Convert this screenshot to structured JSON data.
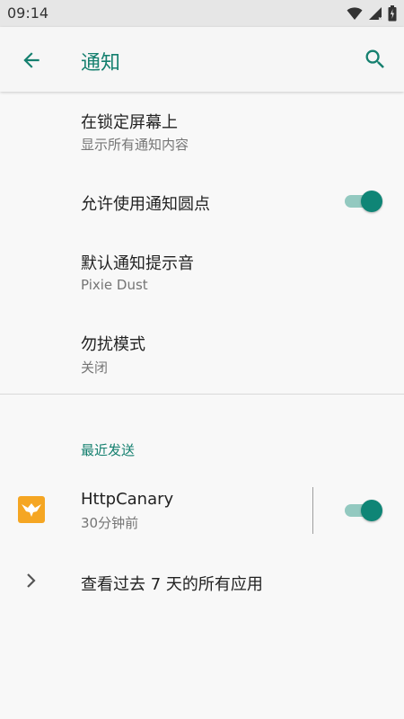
{
  "status_bar": {
    "time": "09:14",
    "icons": [
      "wifi-icon",
      "signal-icon",
      "battery-icon"
    ]
  },
  "app_bar": {
    "title": "通知",
    "back_icon": "arrow-back-icon",
    "search_icon": "search-icon"
  },
  "settings": {
    "lock_screen": {
      "title": "在锁定屏幕上",
      "subtitle": "显示所有通知内容"
    },
    "dots": {
      "title": "允许使用通知圆点",
      "enabled": true
    },
    "sound": {
      "title": "默认通知提示音",
      "subtitle": "Pixie Dust"
    },
    "dnd": {
      "title": "勿扰模式",
      "subtitle": "关闭"
    }
  },
  "recent": {
    "header": "最近发送",
    "apps": [
      {
        "name": "HttpCanary",
        "time": "30分钟前",
        "enabled": true
      }
    ],
    "see_all": "查看过去 7 天的所有应用"
  },
  "colors": {
    "accent": "#15806f",
    "toggle_thumb": "#0f8576",
    "toggle_track": "#93c9c0",
    "app_icon_bg": "#f5a623"
  }
}
